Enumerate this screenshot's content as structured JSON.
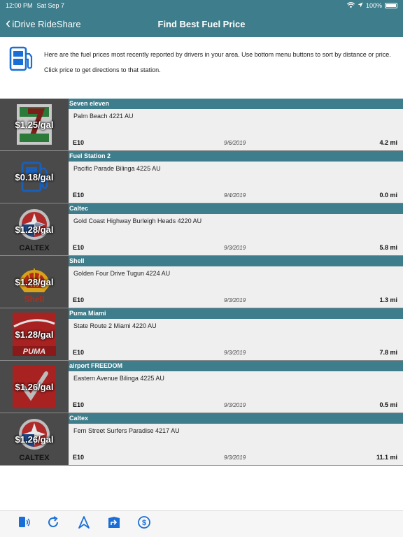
{
  "status_bar": {
    "time": "12:00 PM",
    "date": "Sat Sep 7",
    "battery": "100%"
  },
  "nav": {
    "back_label": "iDrive RideShare",
    "title": "Find Best Fuel Price"
  },
  "info": {
    "line1": "Here are the fuel prices most recently reported by drivers in your area. Use bottom menu buttons to sort by distance or price.",
    "line2": "Click price to get directions to that station."
  },
  "stations": [
    {
      "name": "Seven eleven",
      "price": "$1.25/gal",
      "address": "Palm Beach  4221 AU",
      "fuel": "E10",
      "date": "9/6/2019",
      "distance": "4.2 mi",
      "logo": "7-eleven-logo"
    },
    {
      "name": "Fuel Station 2",
      "price": "$0.18/gal",
      "address": "Pacific Parade Bilinga  4225 AU",
      "fuel": "E10",
      "date": "9/4/2019",
      "distance": "0.0 mi",
      "logo": "fuel-pump-logo"
    },
    {
      "name": "Caltec",
      "price": "$1.28/gal",
      "address": "Gold Coast Highway Burleigh Heads  4220 AU",
      "fuel": "E10",
      "date": "9/3/2019",
      "distance": "5.8 mi",
      "logo": "caltex-logo"
    },
    {
      "name": "Shell",
      "price": "$1.28/gal",
      "address": "Golden Four Drive Tugun  4224 AU",
      "fuel": "E10",
      "date": "9/3/2019",
      "distance": "1.3 mi",
      "logo": "shell-logo"
    },
    {
      "name": "Puma Miami",
      "price": "$1.28/gal",
      "address": "State Route 2 Miami  4220 AU",
      "fuel": "E10",
      "date": "9/3/2019",
      "distance": "7.8 mi",
      "logo": "puma-logo"
    },
    {
      "name": "airport FREEDOM",
      "price": "$1.26/gal",
      "address": "Eastern Avenue Bilinga  4225 AU",
      "fuel": "E10",
      "date": "9/3/2019",
      "distance": "0.5 mi",
      "logo": "freedom-logo"
    },
    {
      "name": "Caltex",
      "price": "$1.26/gal",
      "address": "Fern Street Surfers Paradise  4217 AU",
      "fuel": "E10",
      "date": "9/3/2019",
      "distance": "11.1 mi",
      "logo": "caltex-logo"
    }
  ],
  "tabs": [
    {
      "icon": "report-price-icon"
    },
    {
      "icon": "refresh-icon"
    },
    {
      "icon": "sort-distance-icon"
    },
    {
      "icon": "directions-icon"
    },
    {
      "icon": "sort-price-icon"
    }
  ],
  "colors": {
    "accent": "#3e7d8b",
    "icon_blue": "#1a6fd6",
    "row_bg": "#efefef"
  }
}
